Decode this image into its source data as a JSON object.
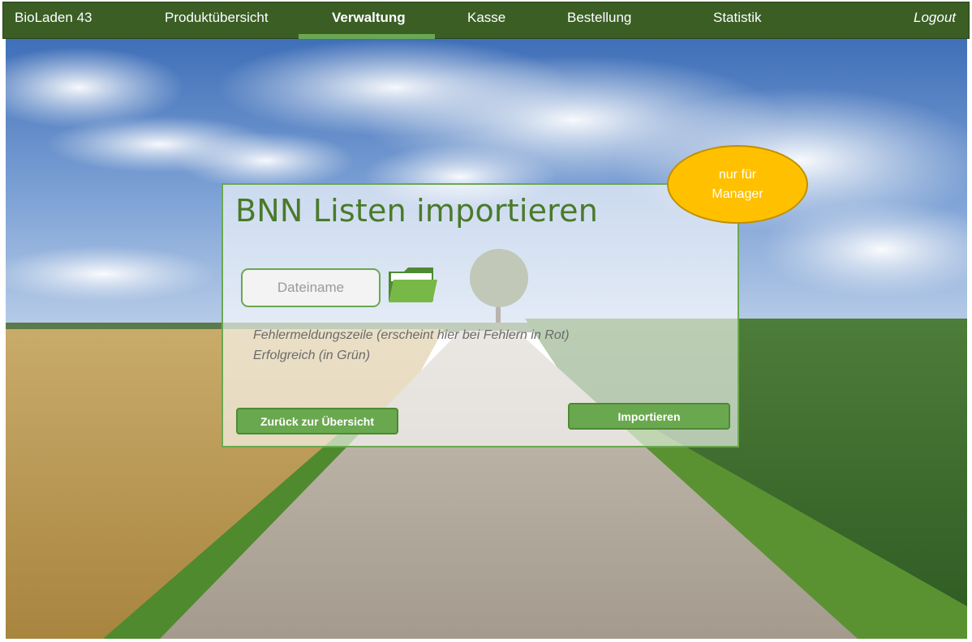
{
  "nav": {
    "brand": "BioLaden 43",
    "items": [
      {
        "label": "Produktübersicht"
      },
      {
        "label": "Verwaltung",
        "active": true
      },
      {
        "label": "Kasse"
      },
      {
        "label": "Bestellung"
      },
      {
        "label": "Statistik"
      }
    ],
    "logout": "Logout"
  },
  "panel": {
    "title": "BNN Listen importieren",
    "file_input": {
      "value": "",
      "placeholder": "Dateiname"
    },
    "folder_icon": "folder-icon",
    "error_line": "Fehlermeldungszeile (erscheint hier bei Fehlern in Rot)",
    "success_line": "Erfolgreich (in Grün)",
    "back_button": "Zurück zur Übersicht",
    "import_button": "Importieren"
  },
  "badge": {
    "text": "nur für Manager"
  },
  "colors": {
    "nav_bg": "#3b5e25",
    "accent_green": "#6aa84f",
    "title_green": "#4a7a2a",
    "badge_yellow": "#ffc000"
  }
}
